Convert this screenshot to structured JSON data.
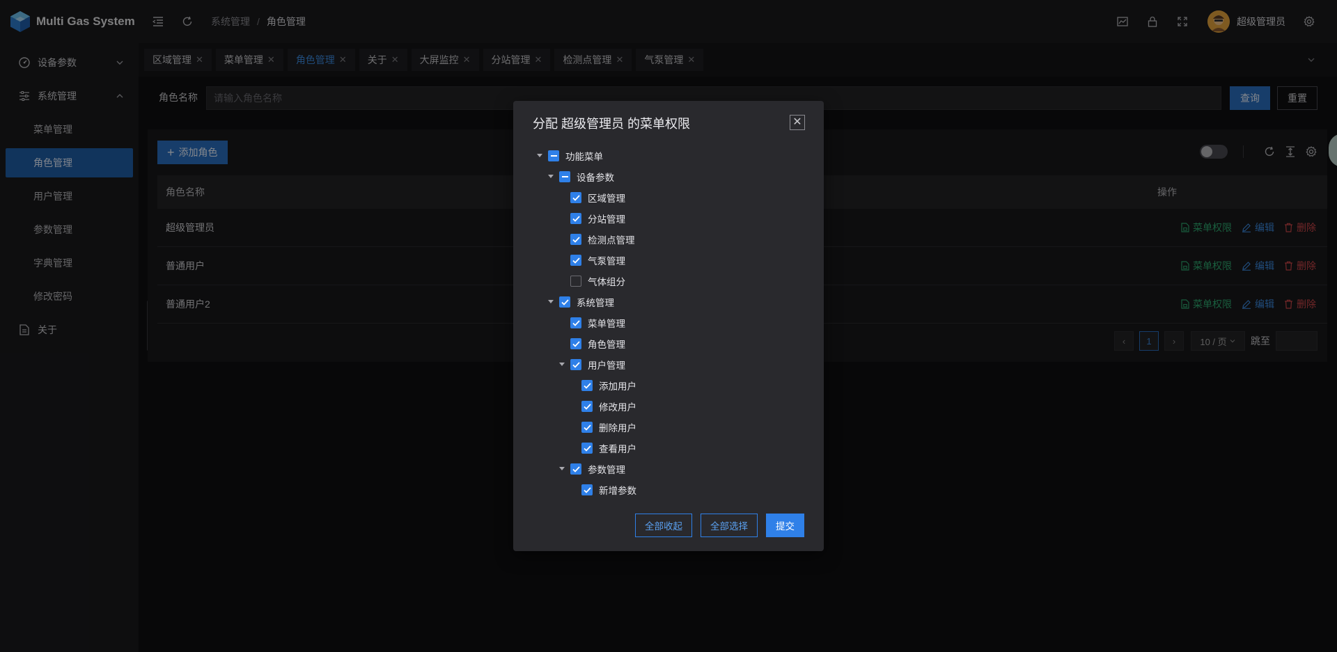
{
  "app": {
    "title": "Multi Gas System"
  },
  "sidebar": {
    "items": [
      {
        "label": "设备参数",
        "icon": "gauge-icon",
        "expanded": false
      },
      {
        "label": "系统管理",
        "icon": "sliders-icon",
        "expanded": true
      }
    ],
    "sub_items": [
      "菜单管理",
      "角色管理",
      "用户管理",
      "参数管理",
      "字典管理",
      "修改密码"
    ],
    "active_sub": "角色管理",
    "about": {
      "label": "关于",
      "icon": "document-icon"
    }
  },
  "header": {
    "breadcrumb": [
      "系统管理",
      "角色管理"
    ],
    "separator": "/",
    "user_name": "超级管理员"
  },
  "tabs": [
    {
      "label": "区域管理",
      "active": false
    },
    {
      "label": "菜单管理",
      "active": false
    },
    {
      "label": "角色管理",
      "active": true
    },
    {
      "label": "关于",
      "active": false
    },
    {
      "label": "大屏监控",
      "active": false
    },
    {
      "label": "分站管理",
      "active": false
    },
    {
      "label": "检测点管理",
      "active": false
    },
    {
      "label": "气泵管理",
      "active": false
    }
  ],
  "search": {
    "label": "角色名称",
    "placeholder": "请输入角色名称",
    "value": "",
    "query_label": "查询",
    "reset_label": "重置"
  },
  "table": {
    "add_label": "添加角色",
    "columns": {
      "name": "角色名称",
      "ops": "操作"
    },
    "rows": [
      {
        "name": "超级管理员"
      },
      {
        "name": "普通用户"
      },
      {
        "name": "普通用户2"
      }
    ],
    "ops": {
      "perm": "菜单权限",
      "edit": "编辑",
      "delete": "删除"
    },
    "pagination": {
      "current_page": "1",
      "page_size": "10 / 页",
      "jump_label": "跳至"
    }
  },
  "modal": {
    "title": "分配 超级管理员 的菜单权限",
    "tree": [
      {
        "label": "功能菜单",
        "level": 0,
        "state": "indeterminate",
        "expandable": true
      },
      {
        "label": "设备参数",
        "level": 1,
        "state": "indeterminate",
        "expandable": true
      },
      {
        "label": "区域管理",
        "level": 2,
        "state": "checked",
        "expandable": false
      },
      {
        "label": "分站管理",
        "level": 2,
        "state": "checked",
        "expandable": false
      },
      {
        "label": "检测点管理",
        "level": 2,
        "state": "checked",
        "expandable": false
      },
      {
        "label": "气泵管理",
        "level": 2,
        "state": "checked",
        "expandable": false
      },
      {
        "label": "气体组分",
        "level": 2,
        "state": "unchecked",
        "expandable": false
      },
      {
        "label": "系统管理",
        "level": 1,
        "state": "checked",
        "expandable": true
      },
      {
        "label": "菜单管理",
        "level": 2,
        "state": "checked",
        "expandable": false
      },
      {
        "label": "角色管理",
        "level": 2,
        "state": "checked",
        "expandable": false
      },
      {
        "label": "用户管理",
        "level": 2,
        "state": "checked",
        "expandable": true
      },
      {
        "label": "添加用户",
        "level": 3,
        "state": "checked",
        "expandable": false
      },
      {
        "label": "修改用户",
        "level": 3,
        "state": "checked",
        "expandable": false
      },
      {
        "label": "删除用户",
        "level": 3,
        "state": "checked",
        "expandable": false
      },
      {
        "label": "查看用户",
        "level": 3,
        "state": "checked",
        "expandable": false
      },
      {
        "label": "参数管理",
        "level": 2,
        "state": "checked",
        "expandable": true
      },
      {
        "label": "新增参数",
        "level": 3,
        "state": "checked",
        "expandable": false
      }
    ],
    "buttons": {
      "collapse_all": "全部收起",
      "select_all": "全部选择",
      "submit": "提交"
    }
  },
  "colors": {
    "accent": "#2f80e8",
    "active_menu": "#1f5fa8",
    "perm_green": "#2eaa70",
    "delete_red": "#d0474a"
  }
}
